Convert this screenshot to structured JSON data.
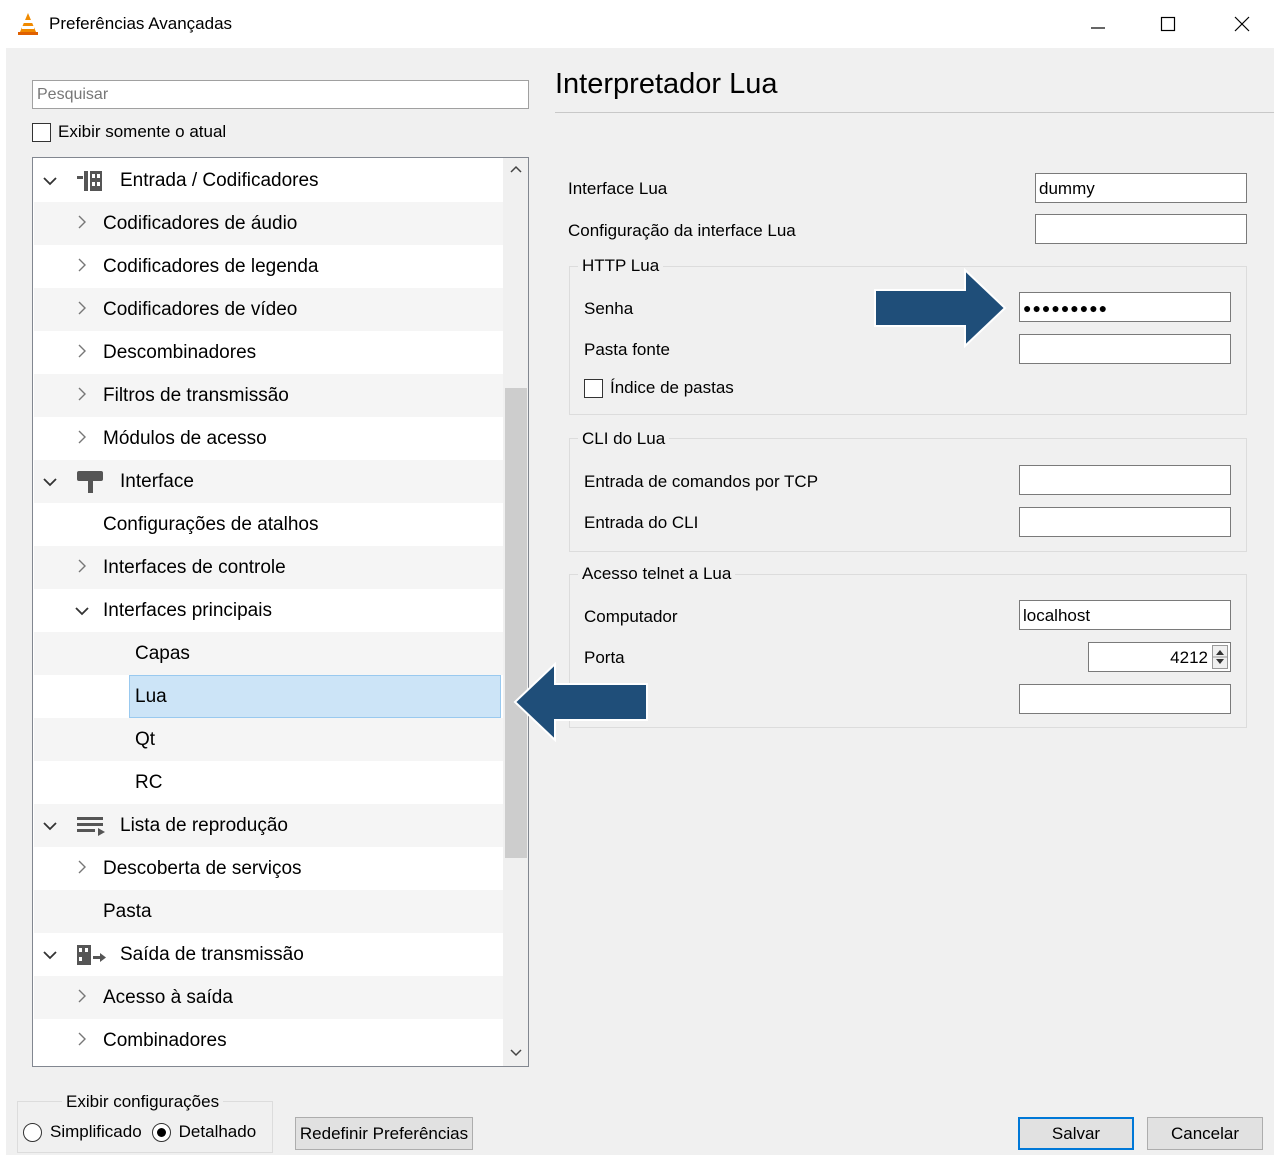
{
  "window": {
    "title": "Preferências Avançadas",
    "icon": "vlc-cone-icon",
    "controls": [
      "minimize-icon",
      "maximize-icon",
      "close-icon"
    ]
  },
  "search": {
    "placeholder": "Pesquisar",
    "value": ""
  },
  "show_current_only": {
    "label": "Exibir somente o atual",
    "checked": false
  },
  "tree": [
    {
      "label": "Entrada / Codificadores",
      "level": 0,
      "expanded": true,
      "icon": "input-codecs-icon"
    },
    {
      "label": "Codificadores de áudio",
      "level": 1,
      "expander": "collapsed"
    },
    {
      "label": "Codificadores de legenda",
      "level": 1,
      "expander": "collapsed"
    },
    {
      "label": "Codificadores de vídeo",
      "level": 1,
      "expander": "collapsed"
    },
    {
      "label": "Descombinadores",
      "level": 1,
      "expander": "collapsed"
    },
    {
      "label": "Filtros de transmissão",
      "level": 1,
      "expander": "collapsed"
    },
    {
      "label": "Módulos de acesso",
      "level": 1,
      "expander": "collapsed"
    },
    {
      "label": "Interface",
      "level": 0,
      "expanded": true,
      "icon": "paint-roller-icon"
    },
    {
      "label": "Configurações de atalhos",
      "level": 1,
      "expander": "none"
    },
    {
      "label": "Interfaces de controle",
      "level": 1,
      "expander": "collapsed"
    },
    {
      "label": "Interfaces principais",
      "level": 1,
      "expander": "expanded"
    },
    {
      "label": "Capas",
      "level": 2
    },
    {
      "label": "Lua",
      "level": 2,
      "selected": true
    },
    {
      "label": "Qt",
      "level": 2
    },
    {
      "label": "RC",
      "level": 2
    },
    {
      "label": "Lista de reprodução",
      "level": 0,
      "expanded": true,
      "icon": "playlist-icon"
    },
    {
      "label": "Descoberta de serviços",
      "level": 1,
      "expander": "collapsed"
    },
    {
      "label": "Pasta",
      "level": 1,
      "expander": "none"
    },
    {
      "label": "Saída de transmissão",
      "level": 0,
      "expanded": true,
      "icon": "stream-output-icon"
    },
    {
      "label": "Acesso à saída",
      "level": 1,
      "expander": "collapsed"
    },
    {
      "label": "Combinadores",
      "level": 1,
      "expander": "collapsed"
    }
  ],
  "panel": {
    "title": "Interpretador Lua",
    "lua_interface": {
      "label": "Interface Lua",
      "value": "dummy"
    },
    "lua_interface_config": {
      "label": "Configuração da interface Lua",
      "value": ""
    },
    "http": {
      "title": "HTTP Lua",
      "password": {
        "label": "Senha",
        "value": "●●●●●●●●●"
      },
      "source_folder": {
        "label": "Pasta fonte",
        "value": ""
      },
      "directory_index": {
        "label": "Índice de pastas",
        "checked": false
      }
    },
    "cli": {
      "title": "CLI do Lua",
      "tcp": {
        "label": "Entrada de comandos por TCP",
        "value": ""
      },
      "cli_input": {
        "label": "Entrada do CLI",
        "value": ""
      }
    },
    "telnet": {
      "title": "Acesso telnet a Lua",
      "host": {
        "label": "Computador",
        "value": "localhost"
      },
      "port": {
        "label": "Porta",
        "value": "4212"
      },
      "password": {
        "value": ""
      }
    }
  },
  "show_settings": {
    "title": "Exibir configurações",
    "simple": "Simplificado",
    "detailed": "Detalhado",
    "selected": "detailed"
  },
  "buttons": {
    "reset": "Redefinir Preferências",
    "save": "Salvar",
    "cancel": "Cancelar"
  },
  "colors": {
    "accent_arrow": "#1f4e79",
    "selection": "#cce4f7",
    "window_bg": "#f0f0f0"
  }
}
